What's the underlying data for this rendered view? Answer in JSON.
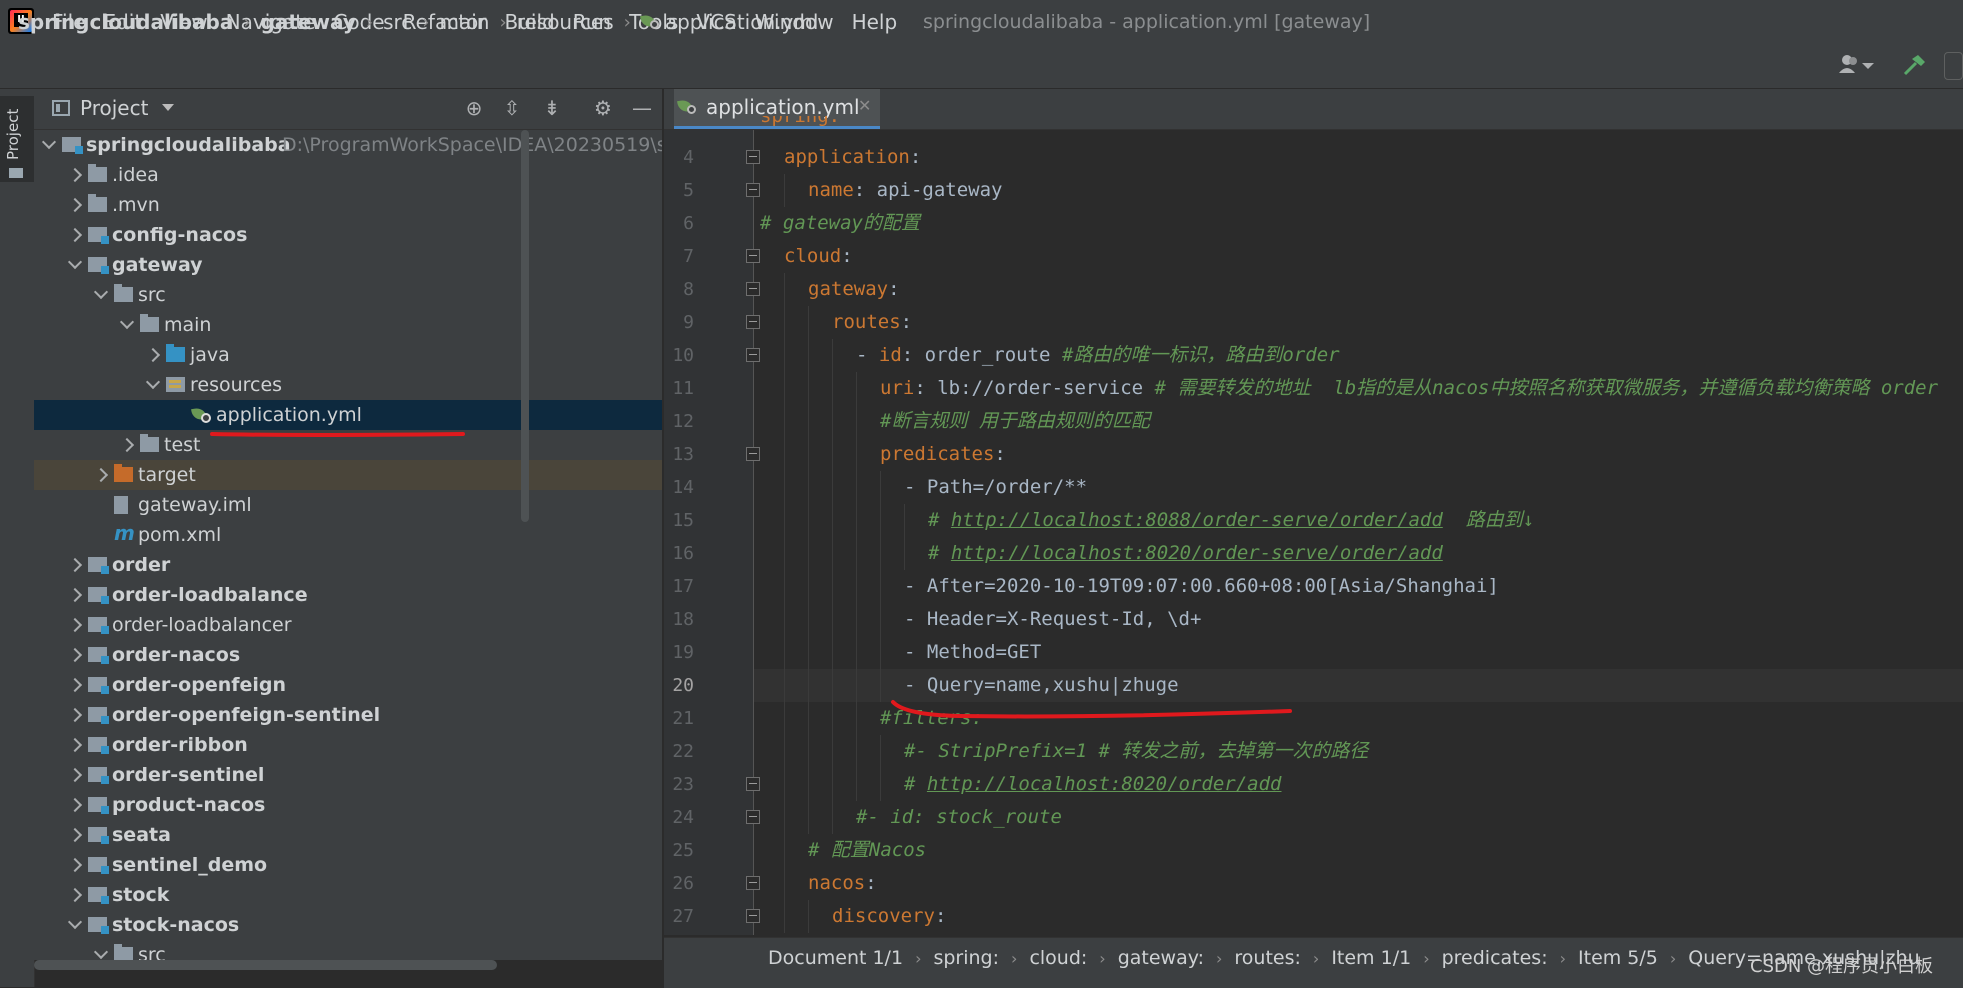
{
  "menubar": {
    "items": [
      "File",
      "Edit",
      "View",
      "Navigate",
      "Code",
      "Refactor",
      "Build",
      "Run",
      "Tools",
      "VCS",
      "Window",
      "Help"
    ],
    "window_title": "springcloudalibaba - application.yml [gateway]"
  },
  "navbar": {
    "crumbs": [
      "springcloudalibaba",
      "gateway",
      "src",
      "main",
      "resources",
      "application.yml"
    ]
  },
  "tool_strip": {
    "project_tab": "Project"
  },
  "project_panel": {
    "title": "Project",
    "root_path": "D:\\ProgramWorkSpace\\IDEA\\20230519\\s",
    "tree": [
      {
        "label": "springcloudalibaba",
        "kind": "module",
        "depth": 0,
        "state": "open",
        "bold": true
      },
      {
        "label": ".idea",
        "kind": "folder",
        "depth": 1,
        "state": "closed",
        "bold": false
      },
      {
        "label": ".mvn",
        "kind": "folder",
        "depth": 1,
        "state": "closed",
        "bold": false
      },
      {
        "label": "config-nacos",
        "kind": "module",
        "depth": 1,
        "state": "closed",
        "bold": true
      },
      {
        "label": "gateway",
        "kind": "module",
        "depth": 1,
        "state": "open",
        "bold": true
      },
      {
        "label": "src",
        "kind": "folder",
        "depth": 2,
        "state": "open",
        "bold": false
      },
      {
        "label": "main",
        "kind": "folder",
        "depth": 3,
        "state": "open",
        "bold": false
      },
      {
        "label": "java",
        "kind": "src-folder",
        "depth": 4,
        "state": "closed",
        "bold": false
      },
      {
        "label": "resources",
        "kind": "res-folder",
        "depth": 4,
        "state": "open",
        "bold": false
      },
      {
        "label": "application.yml",
        "kind": "yml",
        "depth": 5,
        "state": "none",
        "bold": false,
        "selected": true
      },
      {
        "label": "test",
        "kind": "folder",
        "depth": 3,
        "state": "closed",
        "bold": false
      },
      {
        "label": "target",
        "kind": "orange-folder",
        "depth": 2,
        "state": "closed",
        "bold": false,
        "excluded": true
      },
      {
        "label": "gateway.iml",
        "kind": "iml",
        "depth": 2,
        "state": "none",
        "bold": false
      },
      {
        "label": "pom.xml",
        "kind": "mvn",
        "depth": 2,
        "state": "none",
        "bold": false
      },
      {
        "label": "order",
        "kind": "module",
        "depth": 1,
        "state": "closed",
        "bold": true
      },
      {
        "label": "order-loadbalance",
        "kind": "module",
        "depth": 1,
        "state": "closed",
        "bold": true
      },
      {
        "label": "order-loadbalancer",
        "kind": "module",
        "depth": 1,
        "state": "closed",
        "bold": false
      },
      {
        "label": "order-nacos",
        "kind": "module",
        "depth": 1,
        "state": "closed",
        "bold": true
      },
      {
        "label": "order-openfeign",
        "kind": "module",
        "depth": 1,
        "state": "closed",
        "bold": true
      },
      {
        "label": "order-openfeign-sentinel",
        "kind": "module",
        "depth": 1,
        "state": "closed",
        "bold": true
      },
      {
        "label": "order-ribbon",
        "kind": "module",
        "depth": 1,
        "state": "closed",
        "bold": true
      },
      {
        "label": "order-sentinel",
        "kind": "module",
        "depth": 1,
        "state": "closed",
        "bold": true
      },
      {
        "label": "product-nacos",
        "kind": "module",
        "depth": 1,
        "state": "closed",
        "bold": true
      },
      {
        "label": "seata",
        "kind": "module",
        "depth": 1,
        "state": "closed",
        "bold": true
      },
      {
        "label": "sentinel_demo",
        "kind": "module",
        "depth": 1,
        "state": "closed",
        "bold": true
      },
      {
        "label": "stock",
        "kind": "module",
        "depth": 1,
        "state": "closed",
        "bold": true
      },
      {
        "label": "stock-nacos",
        "kind": "module",
        "depth": 1,
        "state": "open",
        "bold": true
      },
      {
        "label": "src",
        "kind": "folder",
        "depth": 2,
        "state": "open",
        "bold": false
      }
    ]
  },
  "editor": {
    "tab_label": "application.yml",
    "current_line": 20,
    "partial_top": "spring:",
    "lines": [
      {
        "n": 4,
        "indent": 1,
        "fold": true,
        "segs": [
          {
            "t": "k",
            "v": "application"
          },
          {
            "t": "p",
            "v": ":"
          }
        ]
      },
      {
        "n": 5,
        "indent": 2,
        "fold": true,
        "segs": [
          {
            "t": "k",
            "v": "name"
          },
          {
            "t": "p",
            "v": ": api-gateway"
          }
        ]
      },
      {
        "n": 6,
        "indent": 0,
        "fold": false,
        "segs": [
          {
            "t": "c",
            "v": "# gateway的配置"
          }
        ]
      },
      {
        "n": 7,
        "indent": 1,
        "fold": true,
        "segs": [
          {
            "t": "k",
            "v": "cloud"
          },
          {
            "t": "p",
            "v": ":"
          }
        ]
      },
      {
        "n": 8,
        "indent": 2,
        "fold": true,
        "segs": [
          {
            "t": "k",
            "v": "gateway"
          },
          {
            "t": "p",
            "v": ":"
          }
        ]
      },
      {
        "n": 9,
        "indent": 3,
        "fold": true,
        "segs": [
          {
            "t": "k",
            "v": "routes"
          },
          {
            "t": "p",
            "v": ":"
          }
        ]
      },
      {
        "n": 10,
        "indent": 4,
        "fold": true,
        "segs": [
          {
            "t": "p",
            "v": "- "
          },
          {
            "t": "k",
            "v": "id"
          },
          {
            "t": "p",
            "v": ": order_route "
          },
          {
            "t": "c",
            "v": "#路由的唯一标识，路由到order"
          }
        ]
      },
      {
        "n": 11,
        "indent": 5,
        "fold": false,
        "segs": [
          {
            "t": "k",
            "v": "uri"
          },
          {
            "t": "p",
            "v": ": lb://order-service "
          },
          {
            "t": "c",
            "v": "# 需要转发的地址  lb指的是从nacos中按照名称获取微服务，并遵循负载均衡策略 order"
          }
        ]
      },
      {
        "n": 12,
        "indent": 5,
        "fold": false,
        "segs": [
          {
            "t": "c",
            "v": "#断言规则 用于路由规则的匹配"
          }
        ]
      },
      {
        "n": 13,
        "indent": 5,
        "fold": true,
        "segs": [
          {
            "t": "k",
            "v": "predicates"
          },
          {
            "t": "p",
            "v": ":"
          }
        ]
      },
      {
        "n": 14,
        "indent": 6,
        "fold": false,
        "segs": [
          {
            "t": "p",
            "v": "- Path=/order/**"
          }
        ]
      },
      {
        "n": 15,
        "indent": 7,
        "fold": false,
        "segs": [
          {
            "t": "c",
            "v": "# "
          },
          {
            "t": "u",
            "v": "http://localhost:8088/order-serve/order/add"
          },
          {
            "t": "c",
            "v": "  路由到↓"
          }
        ]
      },
      {
        "n": 16,
        "indent": 7,
        "fold": false,
        "segs": [
          {
            "t": "c",
            "v": "# "
          },
          {
            "t": "u",
            "v": "http://localhost:8020/order-serve/order/add"
          }
        ]
      },
      {
        "n": 17,
        "indent": 6,
        "fold": false,
        "segs": [
          {
            "t": "p",
            "v": "- After=2020-10-19T09:07:00.660+08:00[Asia/Shanghai]"
          }
        ]
      },
      {
        "n": 18,
        "indent": 6,
        "fold": false,
        "segs": [
          {
            "t": "p",
            "v": "- Header=X-Request-Id, \\d+"
          }
        ]
      },
      {
        "n": 19,
        "indent": 6,
        "fold": false,
        "segs": [
          {
            "t": "p",
            "v": "- Method=GET"
          }
        ]
      },
      {
        "n": 20,
        "indent": 6,
        "fold": false,
        "segs": [
          {
            "t": "p",
            "v": "- Query=name,xushu|zhuge"
          }
        ]
      },
      {
        "n": 21,
        "indent": 5,
        "fold": false,
        "segs": [
          {
            "t": "c",
            "v": "#filters:"
          }
        ]
      },
      {
        "n": 22,
        "indent": 6,
        "fold": false,
        "segs": [
          {
            "t": "c",
            "v": "#- StripPrefix=1 # 转发之前，去掉第一次的路径"
          }
        ]
      },
      {
        "n": 23,
        "indent": 6,
        "fold": true,
        "segs": [
          {
            "t": "c",
            "v": "# "
          },
          {
            "t": "u",
            "v": "http://localhost:8020/order/add"
          }
        ]
      },
      {
        "n": 24,
        "indent": 4,
        "fold": true,
        "segs": [
          {
            "t": "c",
            "v": "#- id: stock_route"
          }
        ]
      },
      {
        "n": 25,
        "indent": 2,
        "fold": false,
        "segs": [
          {
            "t": "c",
            "v": "# 配置Nacos"
          }
        ]
      },
      {
        "n": 26,
        "indent": 2,
        "fold": true,
        "segs": [
          {
            "t": "k",
            "v": "nacos"
          },
          {
            "t": "p",
            "v": ":"
          }
        ]
      },
      {
        "n": 27,
        "indent": 3,
        "fold": true,
        "segs": [
          {
            "t": "k",
            "v": "discovery"
          },
          {
            "t": "p",
            "v": ":"
          }
        ]
      }
    ]
  },
  "statusbar": {
    "crumbs": [
      "Document 1/1",
      "spring:",
      "cloud:",
      "gateway:",
      "routes:",
      "Item 1/1",
      "predicates:",
      "Item 5/5",
      "Query=name,xushu|zhu"
    ]
  },
  "watermark": "CSDN @程序员小白板",
  "colors": {
    "keyword": "#cc7832",
    "comment": "#629755",
    "plain": "#a9b7c6",
    "annotation_red": "#e0191d",
    "selection": "#0d293e"
  }
}
